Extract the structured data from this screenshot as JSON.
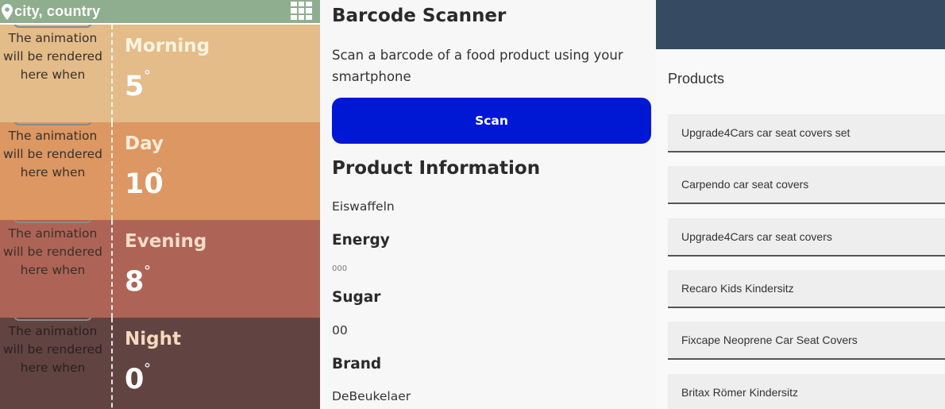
{
  "weather": {
    "location": "city, country",
    "icons": {
      "location": "map-pin-icon",
      "menu": "grid-menu-icon"
    },
    "animation_text": "The animation will be rendered here when",
    "periods": [
      {
        "name": "Morning",
        "temp": "5",
        "degree": "°",
        "bg": "#e3bc89",
        "name_color": "#fff3e0"
      },
      {
        "name": "Day",
        "temp": "10",
        "degree": "°",
        "bg": "#dc9762",
        "name_color": "#fbecd8"
      },
      {
        "name": "Evening",
        "temp": "8",
        "degree": "°",
        "bg": "#ad6456",
        "name_color": "#f7dcc8"
      },
      {
        "name": "Night",
        "temp": "0",
        "degree": "°",
        "bg": "#614441",
        "name_color": "#f5d9bf"
      }
    ]
  },
  "scanner": {
    "title": "Barcode Scanner",
    "intro": "Scan a barcode of a food product using your smartphone",
    "scan_button": "Scan",
    "info_title": "Product Information",
    "product_name": "Eiswaffeln",
    "energy_label": "Energy",
    "energy_value": "000",
    "sugar_label": "Sugar",
    "sugar_value": "00",
    "brand_label": "Brand",
    "brand_value": "DeBeukelaer",
    "button_color": "#0018d4"
  },
  "products": {
    "title": "Products",
    "header_color": "#364a61",
    "items": [
      "Upgrade4Cars car seat covers set",
      "Carpendo car seat covers",
      "Upgrade4Cars car seat covers",
      "Recaro Kids Kindersitz",
      "Fixcape Neoprene Car Seat Covers",
      "Britax Römer Kindersitz"
    ]
  }
}
